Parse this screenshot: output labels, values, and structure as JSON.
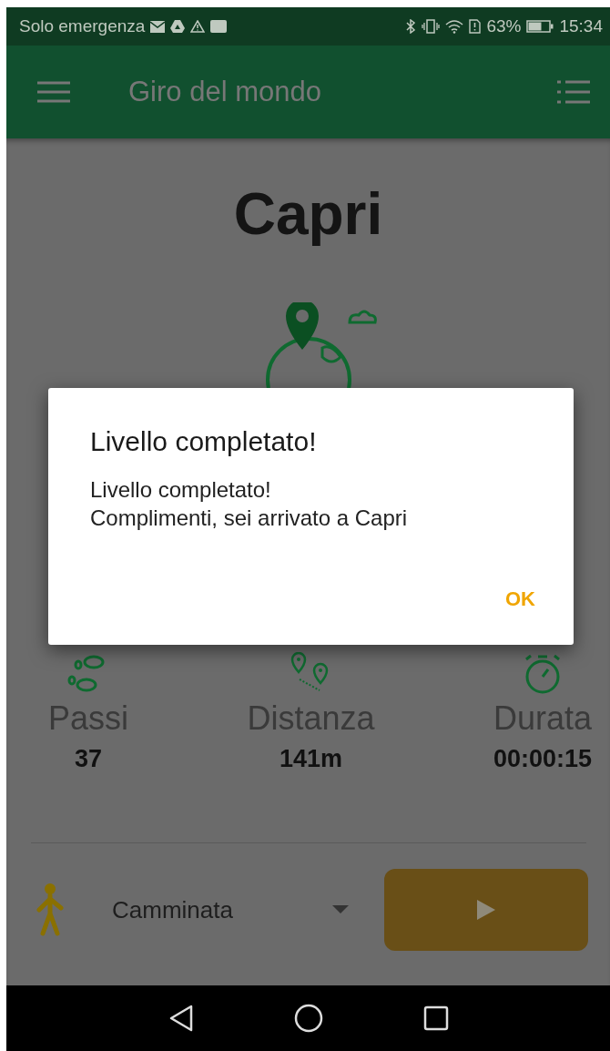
{
  "status_bar": {
    "carrier": "Solo emergenza",
    "battery_percent": "63%",
    "time": "15:34"
  },
  "app_bar": {
    "title": "Giro del mondo"
  },
  "level": {
    "title": "Capri"
  },
  "stats": [
    {
      "kind": "steps",
      "label": "Passi",
      "value": "37"
    },
    {
      "kind": "distance",
      "label": "Distanza",
      "value": "141m"
    },
    {
      "kind": "duration",
      "label": "Durata",
      "value": "00:00:15"
    }
  ],
  "activity": {
    "value": "Camminata"
  },
  "dialog": {
    "title": "Livello completato!",
    "message_lines": [
      "Livello completato!",
      "Complimenti, sei arrivato a Capri"
    ],
    "button": "OK"
  }
}
